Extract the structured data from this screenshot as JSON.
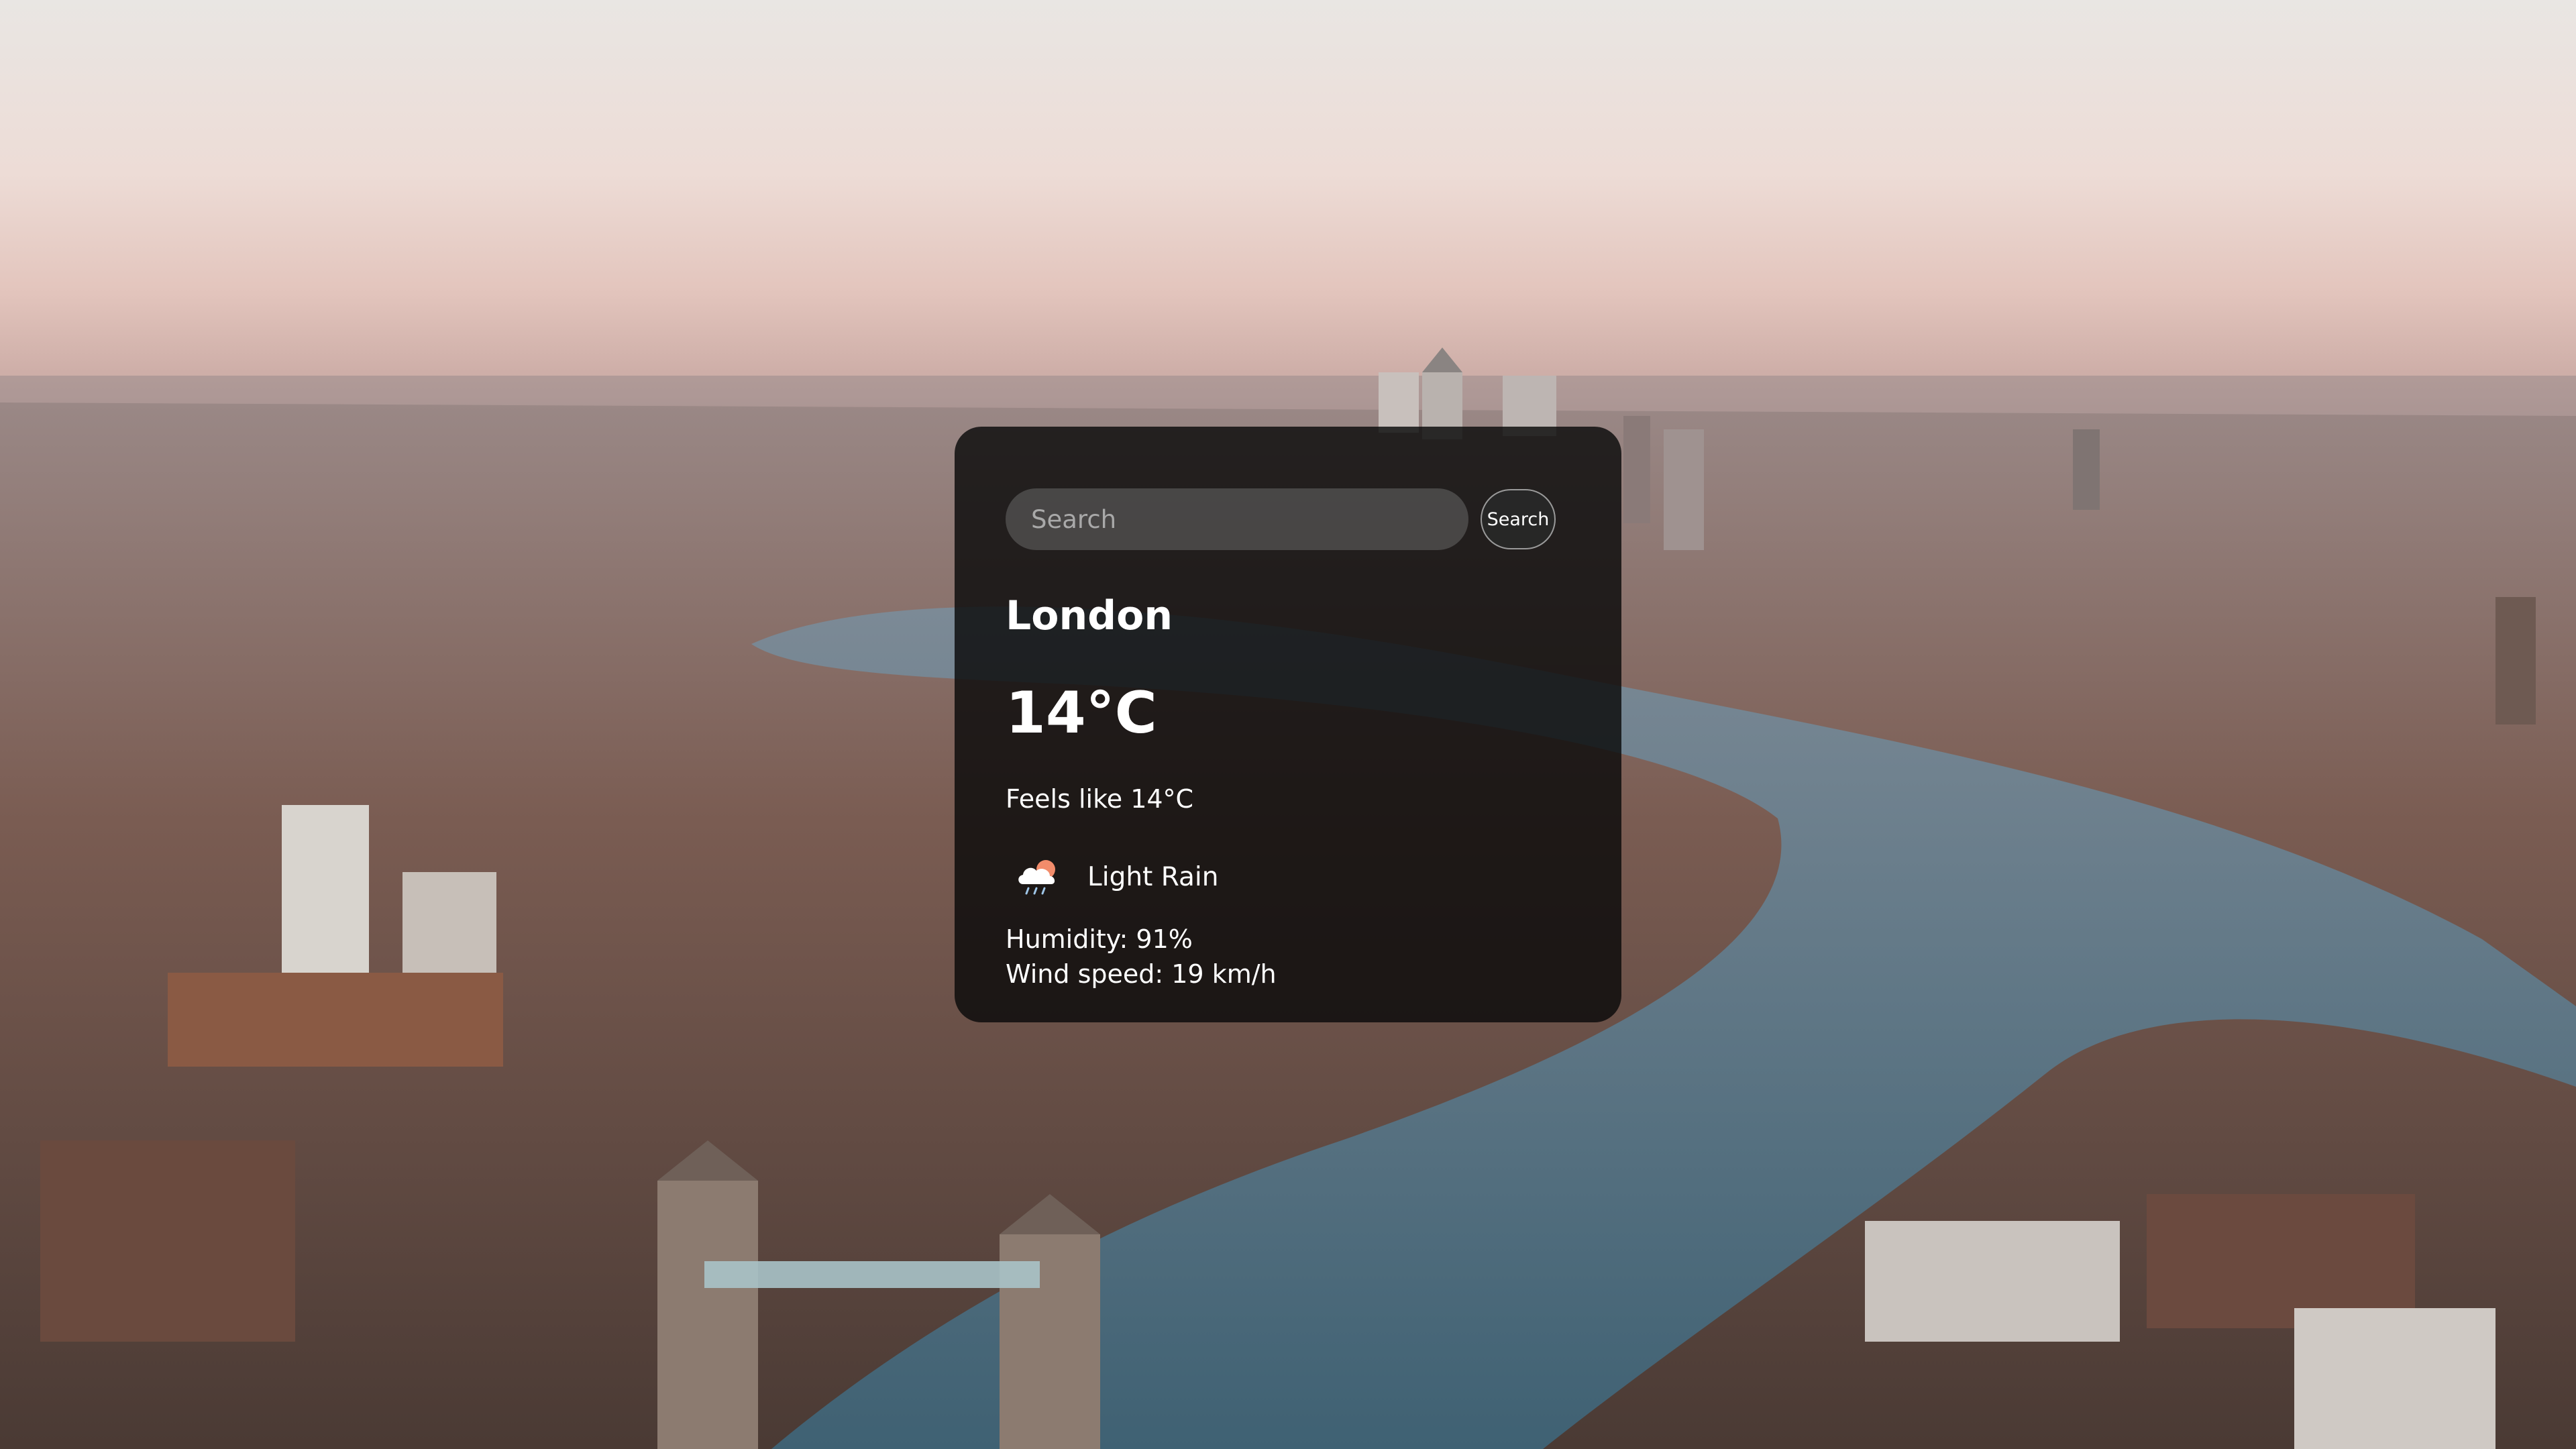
{
  "search": {
    "placeholder": "Search",
    "value": "",
    "button_label": "Search"
  },
  "weather": {
    "city": "London",
    "temperature": "14°C",
    "feels_like": "Feels like 14°C",
    "condition": "Light Rain",
    "condition_icon": "cloud-rain-sun-icon",
    "humidity": "Humidity: 91%",
    "wind_speed": "Wind speed: 19 km/h"
  },
  "colors": {
    "card_background": "#0a0a0a",
    "text": "#ffffff",
    "input_background": "#787878"
  }
}
